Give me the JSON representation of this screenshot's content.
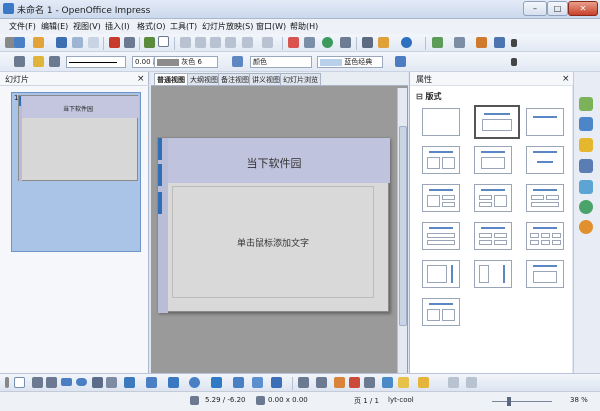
{
  "window": {
    "title": "未命名 1 - OpenOffice Impress",
    "minimize": "–",
    "maximize": "□",
    "close": "✕"
  },
  "menubar": [
    "文件(F)",
    "编辑(E)",
    "视图(V)",
    "插入(I)",
    "格式(O)",
    "工具(T)",
    "幻灯片放映(S)",
    "窗口(W)",
    "帮助(H)"
  ],
  "line_toolbar": {
    "line_width": "0.00 厘米",
    "line_color": "灰色 6",
    "area_style": "颜色",
    "area_color": "蓝色经典"
  },
  "slides_panel": {
    "title": "幻灯片",
    "close": "×",
    "thumb_number": "1",
    "thumb_title": "当下软件园"
  },
  "view_tabs": [
    "普通视图",
    "大纲视图",
    "备注视图",
    "讲义视图",
    "幻灯片浏览"
  ],
  "slide": {
    "title": "当下软件园",
    "body_placeholder": "单击鼠标添加文字"
  },
  "properties_panel": {
    "title": "属性",
    "close": "×",
    "section": "⊟ 版式"
  },
  "status": {
    "position": "5.29 / -6.20",
    "size": "0.00 x 0.00",
    "page": "页 1 / 1",
    "layout": "lyt-cool",
    "zoom": "38 %"
  },
  "colors": {
    "accent": "#2e6fb5",
    "slide_title_bg": "#c0c3dd",
    "slide_bg": "#d9d9d9",
    "selection": "#a9c4e6"
  }
}
